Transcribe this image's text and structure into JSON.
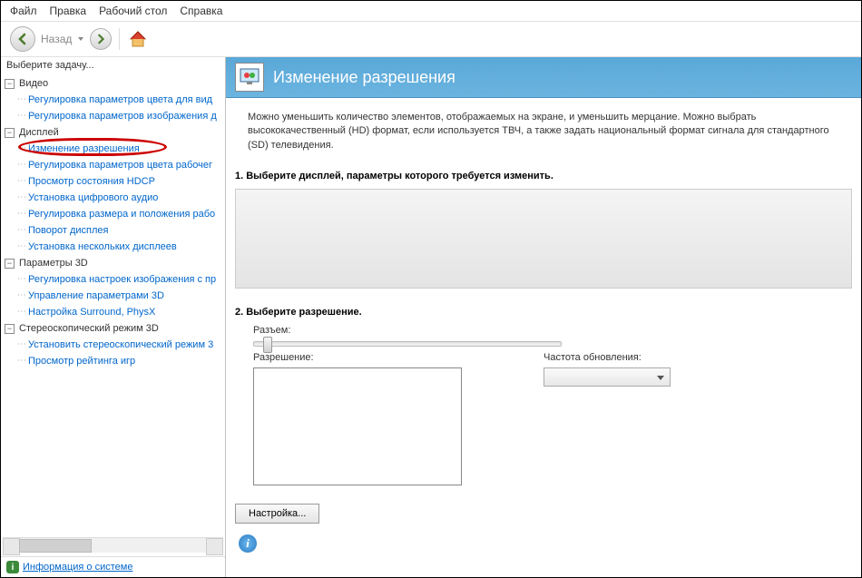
{
  "menu": {
    "file": "Файл",
    "edit": "Правка",
    "desktop": "Рабочий стол",
    "help": "Справка"
  },
  "toolbar": {
    "back_label": "Назад"
  },
  "sidebar": {
    "title": "Выберите задачу...",
    "video": {
      "label": "Видео",
      "items": [
        "Регулировка параметров цвета для вид",
        "Регулировка параметров изображения д"
      ]
    },
    "display": {
      "label": "Дисплей",
      "items": [
        "Изменение разрешения",
        "Регулировка параметров цвета рабочег",
        "Просмотр состояния HDCP",
        "Установка цифрового аудио",
        "Регулировка размера и положения рабо",
        "Поворот дисплея",
        "Установка нескольких дисплеев"
      ]
    },
    "params3d": {
      "label": "Параметры 3D",
      "items": [
        "Регулировка настроек изображения с пр",
        "Управление параметрами 3D",
        "Настройка Surround, PhysX"
      ]
    },
    "stereo": {
      "label": "Стереоскопический режим 3D",
      "items": [
        "Установить стереоскопический режим 3",
        "Просмотр рейтинга игр"
      ]
    },
    "sysinfo": "Информация о системе"
  },
  "page": {
    "title": "Изменение разрешения",
    "description": "Можно уменьшить количество элементов, отображаемых на экране, и уменьшить мерцание. Можно выбрать высококачественный (HD) формат, если используется ТВЧ, а также задать национальный формат сигнала для стандартного (SD) телевидения.",
    "step1": "1. Выберите дисплей, параметры которого требуется изменить.",
    "step2": "2. Выберите разрешение.",
    "connector_label": "Разъем:",
    "resolution_label": "Разрешение:",
    "refresh_label": "Частота обновления:",
    "customize_btn": "Настройка..."
  }
}
